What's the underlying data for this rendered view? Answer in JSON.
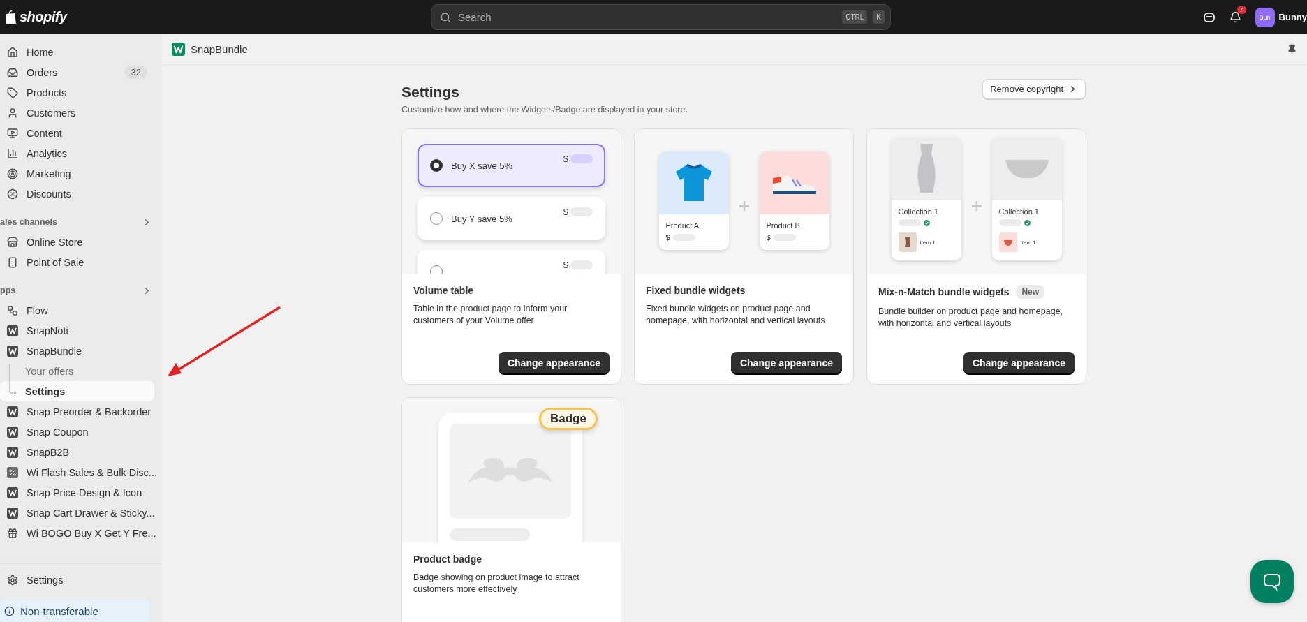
{
  "topbar": {
    "logo": "shopify",
    "search": {
      "placeholder": "Search"
    },
    "keys": [
      "CTRL",
      "K"
    ],
    "notifications": "7",
    "avatar": "Bun",
    "user": "Bunny"
  },
  "sidebar": {
    "main": [
      {
        "label": "Home",
        "selected": false
      },
      {
        "label": "Orders",
        "badge": "32",
        "selected": false
      },
      {
        "label": "Products",
        "selected": false
      },
      {
        "label": "Customers",
        "selected": false
      },
      {
        "label": "Content",
        "selected": false
      },
      {
        "label": "Analytics",
        "selected": false
      },
      {
        "label": "Marketing",
        "selected": false
      },
      {
        "label": "Discounts",
        "selected": false
      }
    ],
    "sections": [
      {
        "title": "ales channels",
        "items": [
          {
            "label": "Online Store",
            "kind": "store"
          },
          {
            "label": "Point of Sale",
            "kind": "pos"
          }
        ]
      },
      {
        "title": "pps",
        "items": [
          {
            "label": "Flow",
            "kind": "flow"
          },
          {
            "label": "SnapNoti",
            "kind": "snap"
          },
          {
            "label": "SnapBundle",
            "kind": "snap",
            "children": [
              {
                "label": "Your offers",
                "selected": false
              },
              {
                "label": "Settings",
                "selected": true
              }
            ]
          },
          {
            "label": "Snap Preorder & Backorder",
            "kind": "snap"
          },
          {
            "label": "Snap Coupon",
            "kind": "snap"
          },
          {
            "label": "SnapB2B",
            "kind": "snap"
          },
          {
            "label": "Wi Flash Sales & Bulk Disc...",
            "kind": "flash"
          },
          {
            "label": "Snap Price Design & Icon",
            "kind": "snap"
          },
          {
            "label": "Snap Cart Drawer & Sticky...",
            "kind": "snap"
          },
          {
            "label": "Wi BOGO Buy X Get Y Fre...",
            "kind": "bogo"
          }
        ]
      }
    ],
    "settings": "Settings",
    "notice": "Non-transferable"
  },
  "app_header": {
    "title": "SnapBundle"
  },
  "page": {
    "title": "Settings",
    "subtitle": "Customize how and where the Widgets/Badge are displayed in your store.",
    "action": "Remove copyright",
    "cards": [
      {
        "kind": "volume",
        "title": "Volume table",
        "description": "Table in the product page to inform your customers of your Volume offer",
        "button": "Change appearance",
        "options": [
          {
            "label": "Buy X save 5%",
            "price": "$",
            "selected": true
          },
          {
            "label": "Buy Y save 5%",
            "price": "$",
            "selected": false
          },
          {
            "price": "$",
            "selected": false
          }
        ]
      },
      {
        "kind": "fixed",
        "title": "Fixed bundle widgets",
        "description": "Fixed bundle widgets on product page and homepage, with horizontal and vertical layouts",
        "button": "Change appearance",
        "products": [
          {
            "name": "Product A",
            "price": "$"
          },
          {
            "name": "Product B",
            "price": "$"
          }
        ]
      },
      {
        "kind": "mix",
        "title": "Mix-n-Match bundle widgets",
        "tag": "New",
        "description": "Bundle builder on product page and homepage, with horizontal and vertical layouts",
        "button": "Change appearance",
        "collections": [
          {
            "name": "Collection 1",
            "item": "Item 1"
          },
          {
            "name": "Collection 1",
            "item": "Item 1"
          }
        ]
      },
      {
        "kind": "badge",
        "title": "Product badge",
        "description": "Badge showing on product image to attract customers more effectively",
        "badge": "Badge"
      }
    ]
  }
}
